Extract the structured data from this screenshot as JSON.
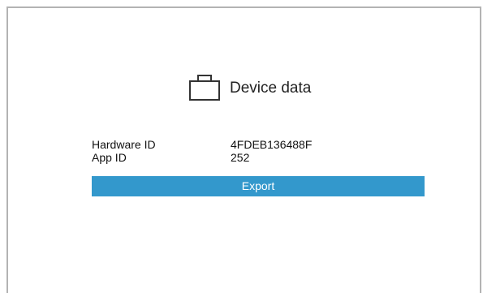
{
  "panel": {
    "title": "Device data",
    "icon": "briefcase-icon"
  },
  "device_info": [
    {
      "label": "Hardware ID",
      "value": "4FDEB136488F"
    },
    {
      "label": "App ID",
      "value": "252"
    }
  ],
  "actions": {
    "export_label": "Export"
  },
  "colors": {
    "accent": "#3398cc",
    "frame_border": "#b3b3b3"
  }
}
